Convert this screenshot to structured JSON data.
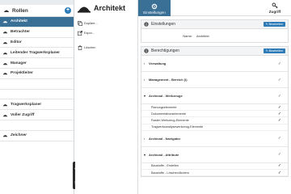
{
  "sidebar": {
    "title": "Rollen",
    "add_label": "+",
    "items": [
      {
        "label": "Architekt",
        "active": true
      },
      {
        "label": "Betrachter"
      },
      {
        "label": "Editor"
      },
      {
        "label": "Leitender Tragwerksplaner"
      },
      {
        "label": "Manager"
      },
      {
        "label": "Projektleiter"
      },
      {
        "label": ""
      },
      {
        "label": ""
      },
      {
        "label": "Tragwerksplaner"
      },
      {
        "label": "Voller Zugriff"
      },
      {
        "label": ""
      },
      {
        "label": "Zeichner",
        "italic": true
      }
    ]
  },
  "middle": {
    "title": "Architekt",
    "actions": [
      {
        "label": "Duplizie..."
      },
      {
        "label": "Expor..."
      },
      {
        "label": ""
      },
      {
        "label": "Löschen"
      }
    ]
  },
  "right": {
    "tab_settings": "Einstellungen",
    "tab_access": "Zugriff",
    "settings_section": {
      "title": "Einstellungen",
      "edit_label": "Bearbeiten",
      "name_label": "Name:",
      "name_value": "Architekt"
    },
    "permissions_section": {
      "title": "Berechtigungen",
      "edit_label": "Bearbeiten",
      "rows": [
        {
          "type": "group",
          "label": "Verwaltung",
          "chevron": "›",
          "check": "✓"
        },
        {
          "type": "group",
          "label": "Management - Bereich (i)",
          "chevron": "›",
          "check": "✓"
        },
        {
          "type": "group",
          "label": "Archicad - Werkzeuge",
          "chevron": "▾",
          "check": "✓"
        },
        {
          "type": "sub",
          "label": "Planungselemente",
          "check": "✓"
        },
        {
          "type": "sub",
          "label": "Dokumentationselemente",
          "check": "✓"
        },
        {
          "type": "sub",
          "label": "Raster-Werkzeug-Elemente",
          "check": "✓"
        },
        {
          "type": "sub",
          "label": "Tragwerksanalysewerkzeug-Elemente",
          "check": ""
        },
        {
          "type": "group",
          "label": "Archicad - Navigator",
          "chevron": "›",
          "check": "✓"
        },
        {
          "type": "group",
          "label": "Archicad - Attribute",
          "chevron": "▾",
          "check": "✓"
        },
        {
          "type": "sub",
          "label": "Baustoffe - Erstellen",
          "check": "✓"
        },
        {
          "type": "sub",
          "label": "Baustoffe - Löschen/Ändern",
          "check": "✓"
        }
      ]
    }
  },
  "colors": {
    "accent": "#3a6f96",
    "button": "#2d7bb6"
  }
}
